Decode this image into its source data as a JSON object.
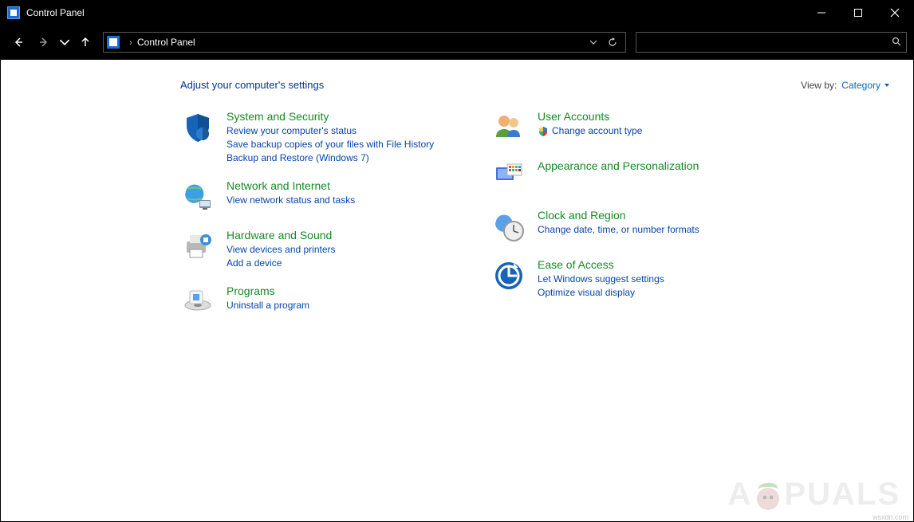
{
  "titlebar": {
    "title": "Control Panel"
  },
  "address": {
    "root": "Control Panel"
  },
  "header": {
    "title": "Adjust your computer's settings",
    "viewby_label": "View by:",
    "viewby_value": "Category"
  },
  "categories": {
    "system_security": {
      "title": "System and Security",
      "links": [
        "Review your computer's status",
        "Save backup copies of your files with File History",
        "Backup and Restore (Windows 7)"
      ]
    },
    "network": {
      "title": "Network and Internet",
      "links": [
        "View network status and tasks"
      ]
    },
    "hardware": {
      "title": "Hardware and Sound",
      "links": [
        "View devices and printers",
        "Add a device"
      ]
    },
    "programs": {
      "title": "Programs",
      "links": [
        "Uninstall a program"
      ]
    },
    "user_accounts": {
      "title": "User Accounts",
      "links": [
        "Change account type"
      ]
    },
    "appearance": {
      "title": "Appearance and Personalization",
      "links": []
    },
    "clock": {
      "title": "Clock and Region",
      "links": [
        "Change date, time, or number formats"
      ]
    },
    "ease": {
      "title": "Ease of Access",
      "links": [
        "Let Windows suggest settings",
        "Optimize visual display"
      ]
    }
  },
  "watermark": {
    "text_left": "A",
    "text_right": "PUALS"
  },
  "source": "wsxdn.com"
}
